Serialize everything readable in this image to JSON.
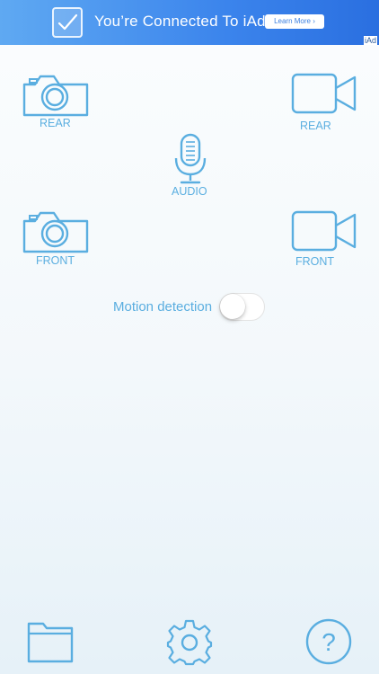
{
  "ad": {
    "title": "You’re Connected To iAd",
    "learn_more": "Learn More",
    "chevron": "›",
    "iad_badge": "iAd",
    "check_icon": "checkmark-icon"
  },
  "rear": {
    "photo_label": "REAR",
    "video_label": "REAR"
  },
  "audio": {
    "label": "AUDIO"
  },
  "front": {
    "photo_label": "FRONT",
    "video_label": "FRONT"
  },
  "motion": {
    "label": "Motion detection",
    "enabled": false
  },
  "toolbar": {
    "folder_icon": "folder-icon",
    "settings_icon": "gear-icon",
    "help_icon": "help-icon",
    "help_glyph": "?"
  },
  "colors": {
    "accent": "#5aaee0",
    "ad_banner": "#3b84ec"
  }
}
